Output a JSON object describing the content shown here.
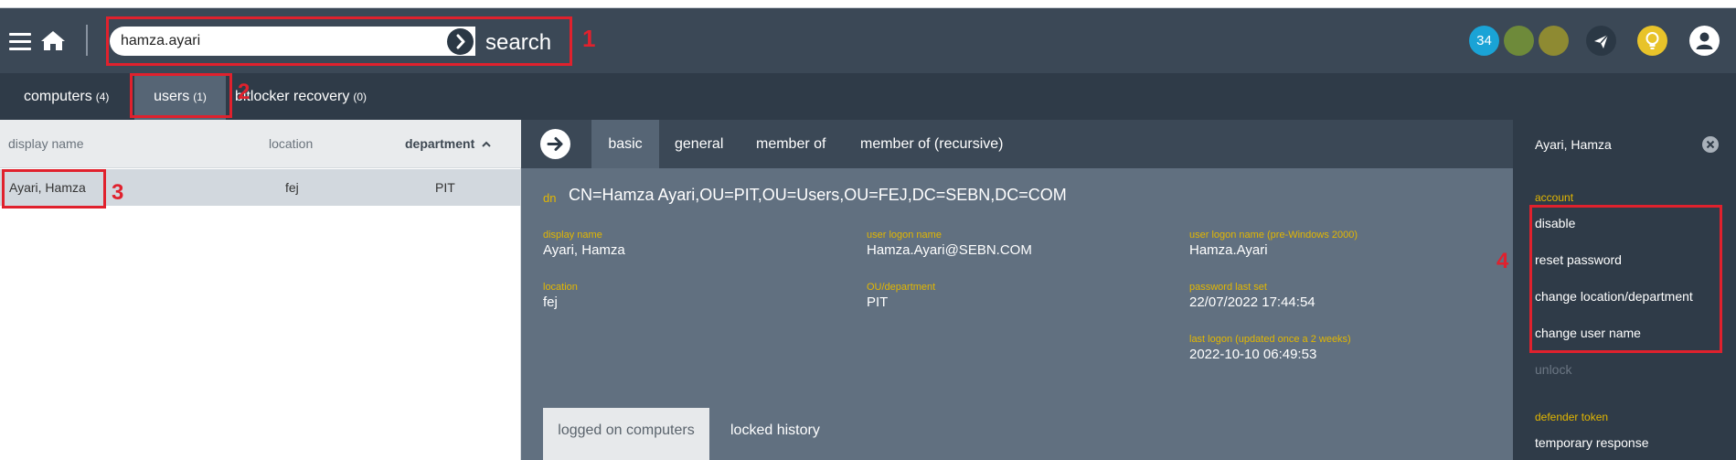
{
  "header": {
    "search_value": "hamza.ayari",
    "search_label": "search",
    "notification_count": "34",
    "status_colors": [
      "#1aa3d6",
      "#6e8a3a",
      "#8e8a32"
    ],
    "icons": [
      "menu-icon",
      "home-icon",
      "chevron-right-icon",
      "paper-plane-icon",
      "lightbulb-icon",
      "user-icon"
    ]
  },
  "tabs": [
    {
      "label": "computers",
      "count": "(4)"
    },
    {
      "label": "users",
      "count": "(1)"
    },
    {
      "label": "bitlocker recovery",
      "count": "(0)"
    }
  ],
  "list": {
    "columns": [
      "display name",
      "location",
      "department"
    ],
    "rows": [
      {
        "display_name": "Ayari, Hamza",
        "location": "fej",
        "department": "PIT"
      }
    ]
  },
  "detail": {
    "tabs": [
      "basic",
      "general",
      "member of",
      "member of (recursive)"
    ],
    "dn_label": "dn",
    "dn_value": "CN=Hamza Ayari,OU=PIT,OU=Users,OU=FEJ,DC=SEBN,DC=COM",
    "fields": {
      "display_name": {
        "label": "display name",
        "value": "Ayari, Hamza"
      },
      "user_logon_name": {
        "label": "user logon name",
        "value": "Hamza.Ayari@SEBN.COM"
      },
      "user_logon_name_pre2000": {
        "label": "user logon name (pre-Windows 2000)",
        "value": "Hamza.Ayari"
      },
      "location": {
        "label": "location",
        "value": "fej"
      },
      "ou_department": {
        "label": "OU/department",
        "value": "PIT"
      },
      "password_last_set": {
        "label": "password last set",
        "value": "22/07/2022 17:44:54"
      },
      "last_logon": {
        "label": "last logon (updated once a 2 weeks)",
        "value": "2022-10-10 06:49:53"
      }
    },
    "bottom_tabs": [
      "logged on computers",
      "locked history"
    ]
  },
  "right_panel": {
    "title": "Ayari, Hamza",
    "account_label": "account",
    "actions": [
      "disable",
      "reset password",
      "change location/department",
      "change user name"
    ],
    "disabled_action": "unlock",
    "token_label": "defender token",
    "token_action": "temporary response"
  },
  "annotations": [
    "1",
    "2",
    "3",
    "4"
  ],
  "colors": {
    "annotation_red": "#e0212d",
    "accent_yellow": "#e3b700",
    "topbar": "#3b4856"
  }
}
